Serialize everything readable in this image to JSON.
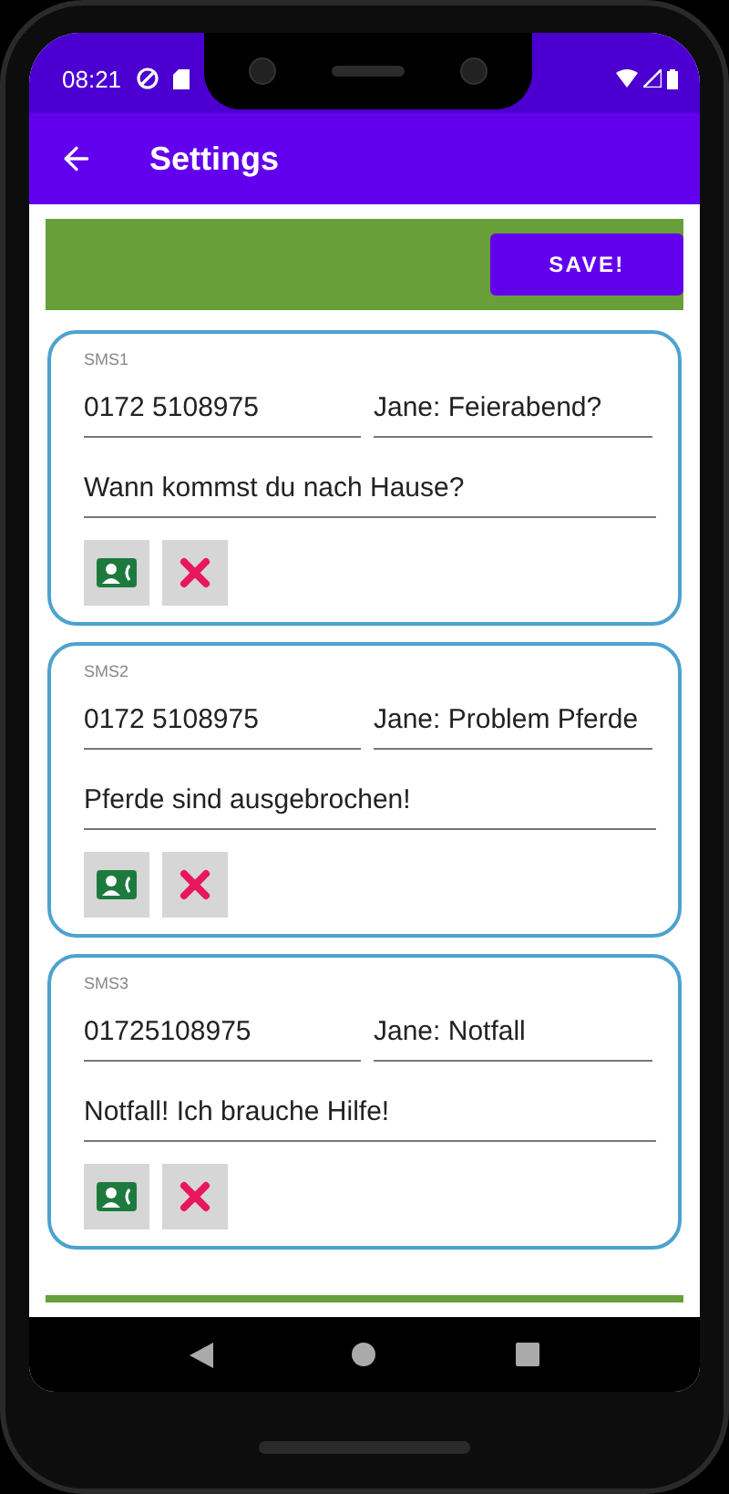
{
  "status_bar": {
    "time": "08:21"
  },
  "app_bar": {
    "title": "Settings"
  },
  "save_button": "SAVE!",
  "messages": [
    {
      "label": "SMS1",
      "phone": "0172 5108975",
      "subject": "Jane: Feierabend?",
      "text": "Wann kommst du nach Hause?"
    },
    {
      "label": "SMS2",
      "phone": "0172 5108975",
      "subject": "Jane: Problem Pferde",
      "text": "Pferde sind ausgebrochen!"
    },
    {
      "label": "SMS3",
      "phone": "01725108975",
      "subject": "Jane: Notfall",
      "text": "Notfall! Ich brauche Hilfe!"
    }
  ]
}
